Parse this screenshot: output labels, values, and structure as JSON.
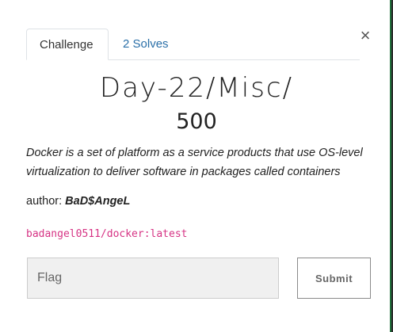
{
  "modal": {
    "close_glyph": "×",
    "tabs": [
      {
        "label": "Challenge",
        "active": true
      },
      {
        "label": "2 Solves",
        "active": false
      }
    ],
    "challenge": {
      "name": "Day-22/Misc/",
      "value": "500",
      "description": "Docker is a set of platform as a service products that use OS-level virtualization to deliver software in packages called containers",
      "author_label": "author: ",
      "author_name": "BaD$AngeL",
      "docker_image": "badangel0511/docker:latest"
    },
    "flag_input": {
      "placeholder": "Flag",
      "value": ""
    },
    "submit_label": "Submit"
  },
  "colors": {
    "link": "#2a6fa8",
    "code": "#d63384",
    "input_bg": "#f0f0f0",
    "accent_border": "#1f6f3a"
  }
}
